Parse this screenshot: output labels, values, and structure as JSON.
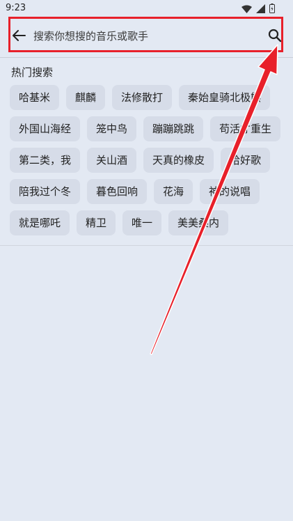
{
  "status_bar": {
    "time": "9:23"
  },
  "search": {
    "placeholder": "搜索你想搜的音乐或歌手",
    "value": ""
  },
  "hot_searches": {
    "title": "热门搜索",
    "rows": [
      [
        "哈基米",
        "麒麟",
        "法修散打",
        "秦始皇骑北极熊"
      ],
      [
        "外国山海经",
        "笼中鸟",
        "蹦蹦跳跳",
        "苟活才重生"
      ],
      [
        "第二类，我",
        "关山酒",
        "天真的橡皮",
        "哈好歌"
      ],
      [
        "陪我过个冬",
        "暮色回响",
        "花海",
        "神的说唱"
      ],
      [
        "就是哪吒",
        "精卫",
        "唯一",
        "美美桑内"
      ]
    ]
  },
  "colors": {
    "background": "#e3e9f3",
    "chip": "#d6dce8",
    "highlight": "#e8202a"
  },
  "icons": {
    "back": "arrow-left-icon",
    "search": "magnifier-icon",
    "wifi": "wifi-icon",
    "signal": "signal-icon",
    "battery": "battery-icon"
  }
}
